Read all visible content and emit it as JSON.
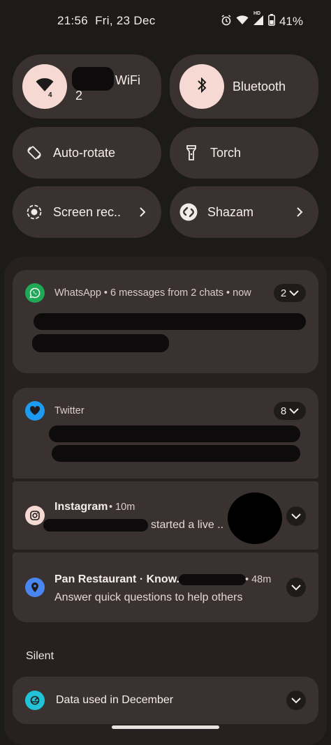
{
  "status_bar": {
    "time": "21:56",
    "date": "Fri, 23 Dec",
    "network_badge": "HD",
    "battery": "41%"
  },
  "quick_settings": {
    "wifi": {
      "label": "WiFi",
      "sub": "2",
      "badge": "4"
    },
    "bluetooth": {
      "label": "Bluetooth"
    },
    "autorotate": {
      "label": "Auto-rotate"
    },
    "torch": {
      "label": "Torch"
    },
    "screen_rec": {
      "label": "Screen rec.."
    },
    "shazam": {
      "label": "Shazam"
    }
  },
  "notifications": {
    "whatsapp": {
      "header": "WhatsApp • 6 messages from 2 chats • now",
      "count": "2",
      "icon_color": "#1fa855"
    },
    "twitter": {
      "header": "Twitter",
      "count": "8",
      "icon_color": "#1d9bf0"
    },
    "instagram": {
      "title": "Instagram",
      "time": "• 10m",
      "body": "started a live .."
    },
    "maps": {
      "title": "Pan Restaurant · Know..",
      "time": "• 48m",
      "body": "Answer quick questions to help others"
    }
  },
  "silent": {
    "label": "Silent",
    "data_usage": {
      "title": "Data used in December"
    }
  },
  "colors": {
    "accent": "#f6d9d2",
    "tile_bg": "#3a3230",
    "panel_bg": "#262120"
  }
}
